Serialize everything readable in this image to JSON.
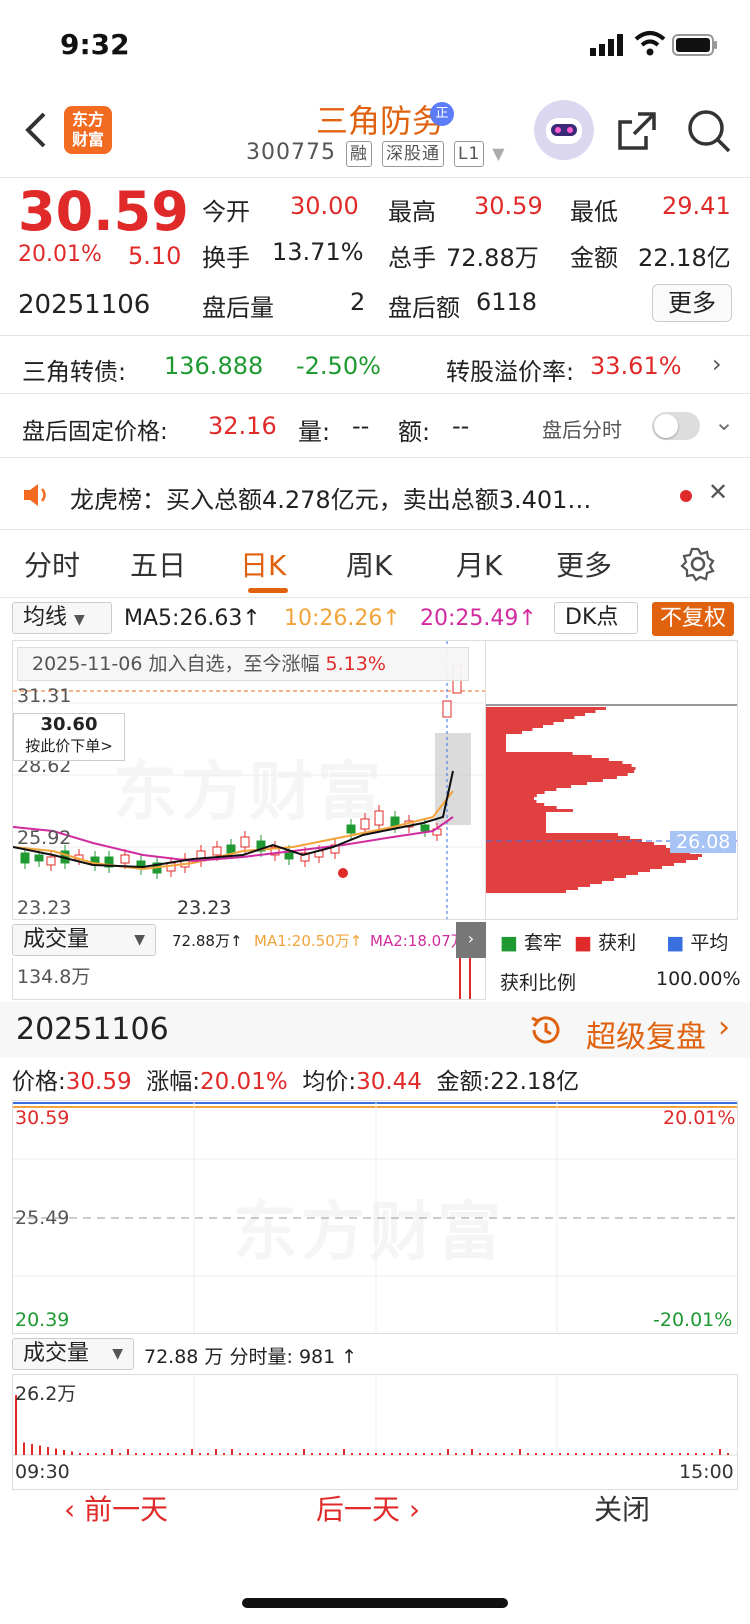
{
  "status": {
    "time": "9:32"
  },
  "header": {
    "logo_text": "东方财富",
    "stock_name": "三角防务",
    "name_badge": "正",
    "stock_code": "300775",
    "tags": [
      "融",
      "深股通",
      "L1"
    ]
  },
  "quote": {
    "price": "30.59",
    "change_pct": "20.01%",
    "change_amt": "5.10",
    "date": "20251106",
    "open_label": "今开",
    "open": "30.00",
    "high_label": "最高",
    "high": "30.59",
    "low_label": "最低",
    "low": "29.41",
    "turnover_label": "换手",
    "turnover": "13.71%",
    "volume_label": "总手",
    "volume": "72.88万",
    "amount_label": "金额",
    "amount": "22.18亿",
    "after_vol_label": "盘后量",
    "after_vol": "2",
    "after_amt_label": "盘后额",
    "after_amt": "6118",
    "more_button": "更多"
  },
  "bond": {
    "label": "三角转债:",
    "price": "136.888",
    "change": "-2.50%",
    "premium_label": "转股溢价率:",
    "premium": "33.61%"
  },
  "after_hours": {
    "price_label": "盘后固定价格:",
    "price": "32.16",
    "vol_label": "量:",
    "vol": "--",
    "amt_label": "额:",
    "amt": "--",
    "timeshare_label": "盘后分时"
  },
  "notice": {
    "text": "龙虎榜：买入总额4.278亿元，卖出总额3.401…"
  },
  "tabs": [
    "分时",
    "五日",
    "日K",
    "周K",
    "月K",
    "更多"
  ],
  "ma_bar": {
    "select": "均线",
    "ma5": "MA5:26.63↑",
    "ma10": "10:26.26↑",
    "ma20": "20:25.49↑",
    "dk": "DK点",
    "fuquan": "不复权"
  },
  "kline": {
    "tooltip_date": "2025-11-06",
    "tooltip_text": "加入自选，至今涨幅",
    "tooltip_pct": "5.13%",
    "y_top": "31.31",
    "y_mid1": "28.62",
    "y_mid2": "25.92",
    "y_low": "23.23",
    "low_marker": "23.23",
    "order_price": "30.60",
    "order_text": "按此价下单>",
    "chip_price": "26.08"
  },
  "chip_legend": {
    "trapped": "套牢",
    "profit": "获利",
    "avg": "平均",
    "ratio_label": "获利比例",
    "ratio": "100.00%"
  },
  "vol_bar": {
    "select": "成交量",
    "vol": "72.88万↑",
    "ma1": "MA1:20.50万↑",
    "ma2": "MA2:18.07万",
    "y_top": "134.8万"
  },
  "replay": {
    "date": "20251106",
    "label": "超级复盘"
  },
  "intraday": {
    "price_label": "价格:",
    "price": "30.59",
    "pct_label": "涨幅:",
    "pct": "20.01%",
    "avg_label": "均价:",
    "avg": "30.44",
    "amt_label": "金额:",
    "amt": "22.18亿",
    "y_top": "30.59",
    "y_mid": "25.49",
    "y_low": "20.39",
    "pct_top": "20.01%",
    "pct_low": "-20.01%",
    "vol_select": "成交量",
    "vol": "72.88 万",
    "tick_label": "分时量:",
    "tick": "981 ↑",
    "vol_top": "26.2万",
    "t_start": "09:30",
    "t_end": "15:00"
  },
  "footer": {
    "prev": "前一天",
    "next": "后一天",
    "close": "关闭"
  },
  "colors": {
    "up": "#e02a2a",
    "down": "#1f9a33",
    "accent": "#e0620f",
    "ma5": "#111111",
    "ma10": "#f2a33a",
    "ma20": "#d12c9f"
  }
}
